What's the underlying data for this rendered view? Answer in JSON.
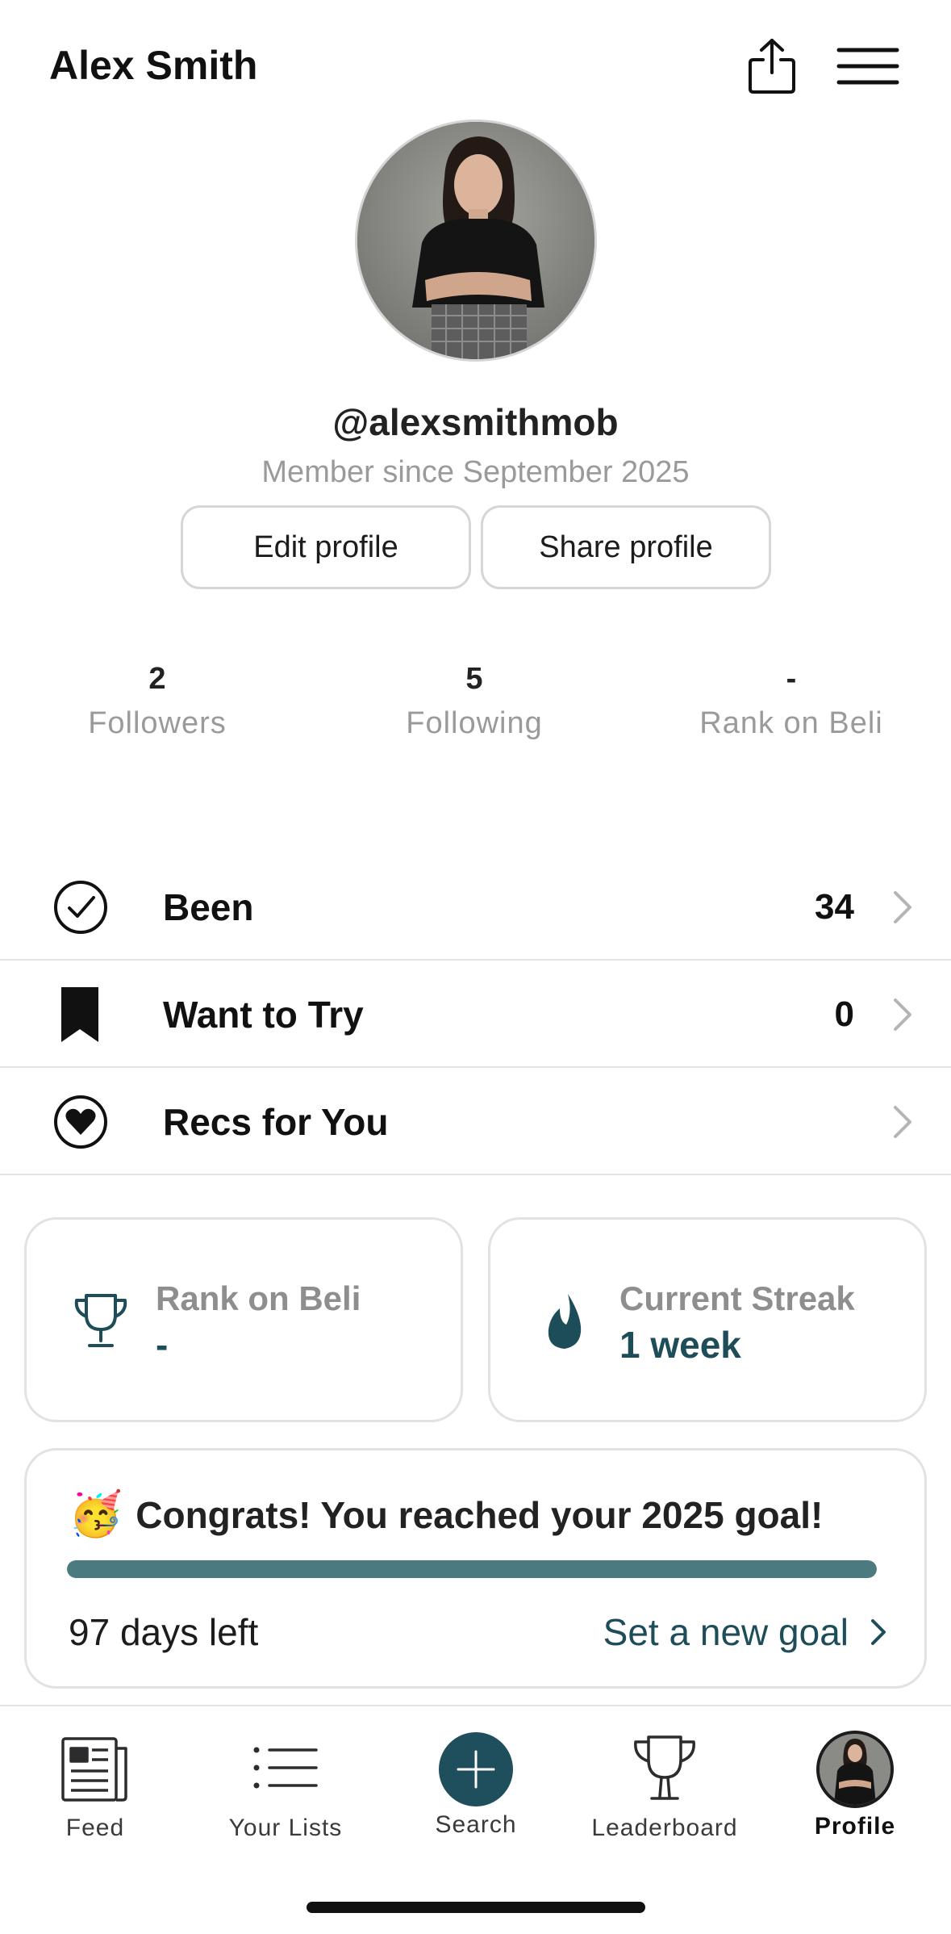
{
  "header": {
    "name": "Alex Smith",
    "share_icon": "share-icon",
    "menu_icon": "hamburger-menu-icon"
  },
  "profile": {
    "handle": "@alexsmithmob",
    "member_since": "Member since September 2025",
    "edit_label": "Edit profile",
    "share_label": "Share profile"
  },
  "stats": [
    {
      "value": "2",
      "label": "Followers"
    },
    {
      "value": "5",
      "label": "Following"
    },
    {
      "value": "-",
      "label": "Rank on Beli"
    }
  ],
  "lists": [
    {
      "icon": "check-circle-icon",
      "title": "Been",
      "count": "34"
    },
    {
      "icon": "bookmark-icon",
      "title": "Want to Try",
      "count": "0"
    },
    {
      "icon": "heart-circle-icon",
      "title": "Recs for You",
      "count": ""
    }
  ],
  "cards": [
    {
      "icon": "trophy-icon",
      "label": "Rank on Beli",
      "value": "-"
    },
    {
      "icon": "flame-icon",
      "label": "Current Streak",
      "value": "1 week"
    }
  ],
  "goal": {
    "emoji": "🥳",
    "title": "Congrats! You reached your 2025 goal!",
    "progress_percent": 100,
    "days_left": "97 days left",
    "link": "Set a new goal"
  },
  "tabs": [
    {
      "label": "Feed",
      "icon": "newspaper-icon"
    },
    {
      "label": "Your Lists",
      "icon": "list-icon"
    },
    {
      "label": "Search",
      "icon": "plus-icon"
    },
    {
      "label": "Leaderboard",
      "icon": "trophy-icon"
    },
    {
      "label": "Profile",
      "icon": "avatar",
      "active": true
    }
  ],
  "colors": {
    "accent": "#1e4d5a",
    "progress": "#4b7a81",
    "muted": "#9a9a9a"
  }
}
